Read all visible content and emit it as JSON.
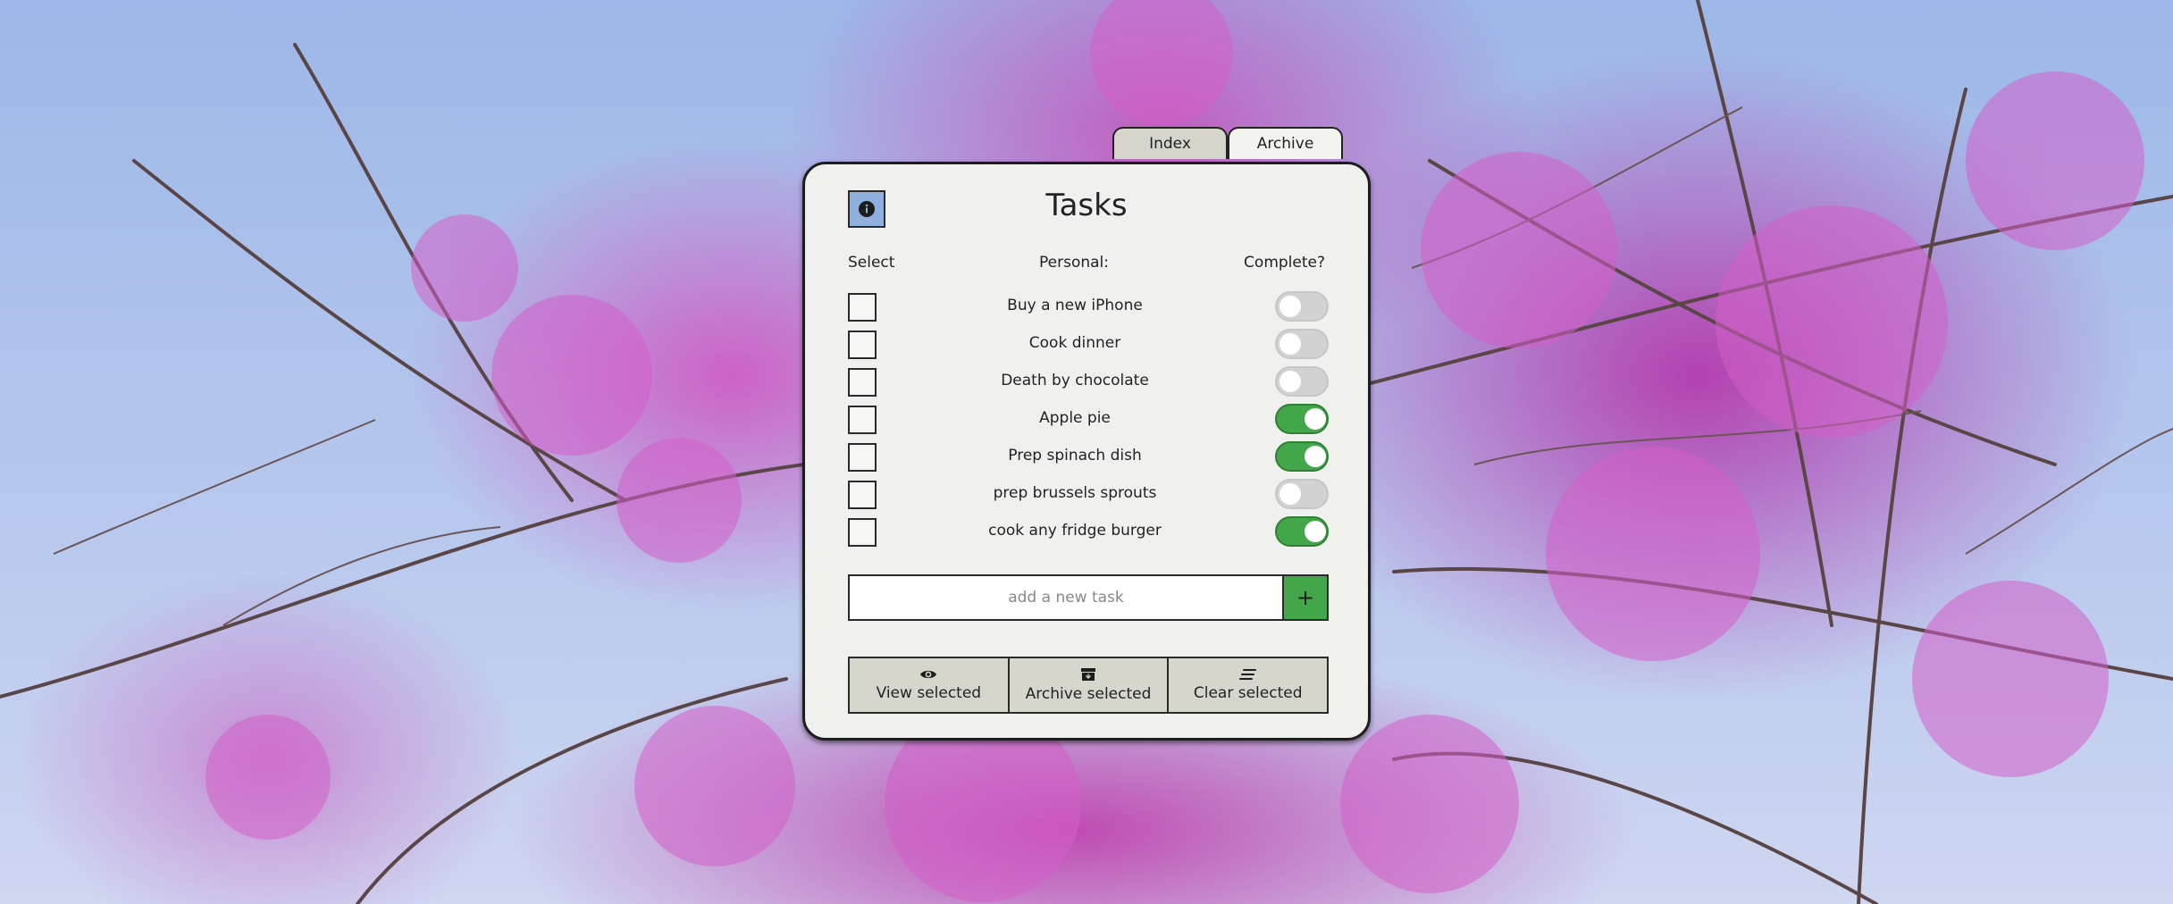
{
  "tabs": [
    {
      "label": "Index"
    },
    {
      "label": "Archive"
    }
  ],
  "card": {
    "title": "Tasks",
    "info_icon": "info-icon",
    "columns": {
      "select": "Select",
      "category": "Personal:",
      "complete": "Complete?"
    }
  },
  "tasks": [
    {
      "label": "Buy a new iPhone",
      "complete": false
    },
    {
      "label": "Cook dinner",
      "complete": false
    },
    {
      "label": "Death by chocolate",
      "complete": false
    },
    {
      "label": "Apple pie",
      "complete": true
    },
    {
      "label": "Prep spinach dish",
      "complete": true
    },
    {
      "label": "prep brussels sprouts",
      "complete": false
    },
    {
      "label": "cook any fridge burger",
      "complete": true
    }
  ],
  "add_task": {
    "placeholder": "add a new task",
    "value": "",
    "button_label": "+"
  },
  "actions": [
    {
      "label": "View selected",
      "icon": "eye-icon"
    },
    {
      "label": "Archive selected",
      "icon": "archive-icon"
    },
    {
      "label": "Clear selected",
      "icon": "clear-icon"
    }
  ],
  "colors": {
    "accent_green": "#43a64a",
    "info_blue": "#8fb0df",
    "card_bg": "#f0f0ee",
    "blossom": "#c04dbb"
  }
}
